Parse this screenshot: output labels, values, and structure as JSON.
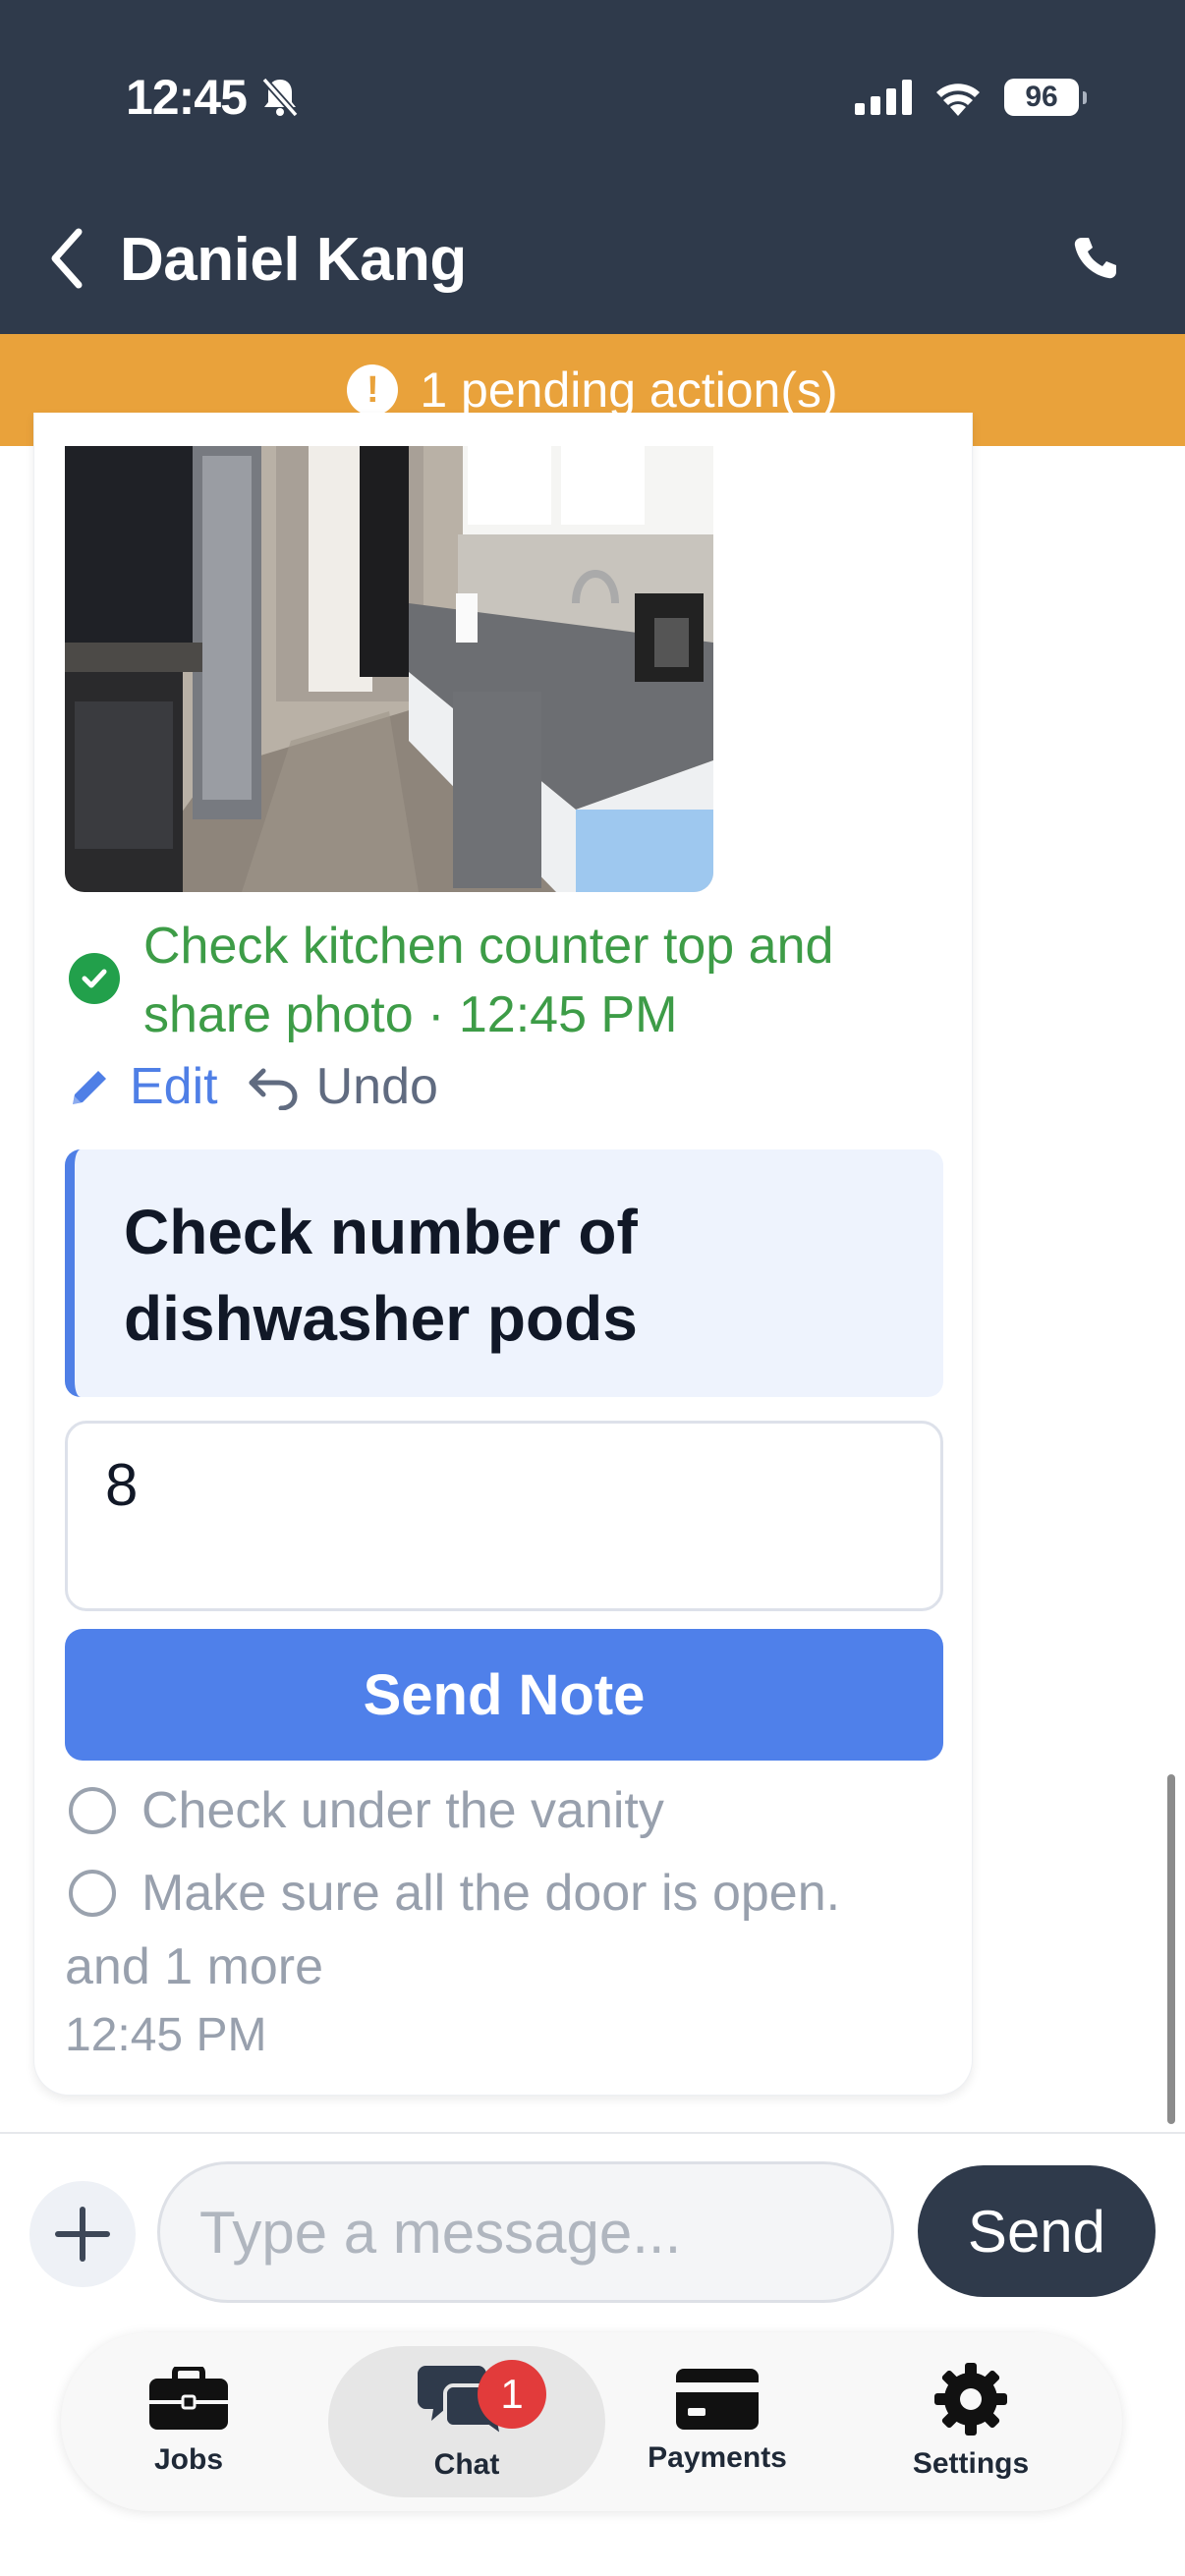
{
  "status_bar": {
    "time": "12:45",
    "battery": "96"
  },
  "header": {
    "contact_name": "Daniel Kang"
  },
  "pending_banner": {
    "text": "1 pending action(s)"
  },
  "message": {
    "completed_task": "Check kitchen counter top and share photo · 12:45 PM",
    "edit_label": "Edit",
    "undo_label": "Undo",
    "current_task": "Check number of dishwasher pods",
    "note_value": "8",
    "send_note_label": "Send Note",
    "todos": [
      "Check under the vanity",
      "Make sure all the door is open."
    ],
    "more_text": "and 1 more",
    "timestamp": "12:45 PM"
  },
  "composer": {
    "placeholder": "Type a message...",
    "send_label": "Send"
  },
  "tabs": [
    {
      "label": "Jobs",
      "icon": "briefcase-icon"
    },
    {
      "label": "Chat",
      "icon": "chat-bubbles-icon",
      "badge": "1",
      "active": true
    },
    {
      "label": "Payments",
      "icon": "credit-card-icon"
    },
    {
      "label": "Settings",
      "icon": "gear-icon"
    }
  ],
  "colors": {
    "header_bg": "#2f3a4b",
    "banner": "#e9a23b",
    "accent": "#4f80ea",
    "success": "#3d9c47",
    "badge": "#e23b3b"
  }
}
